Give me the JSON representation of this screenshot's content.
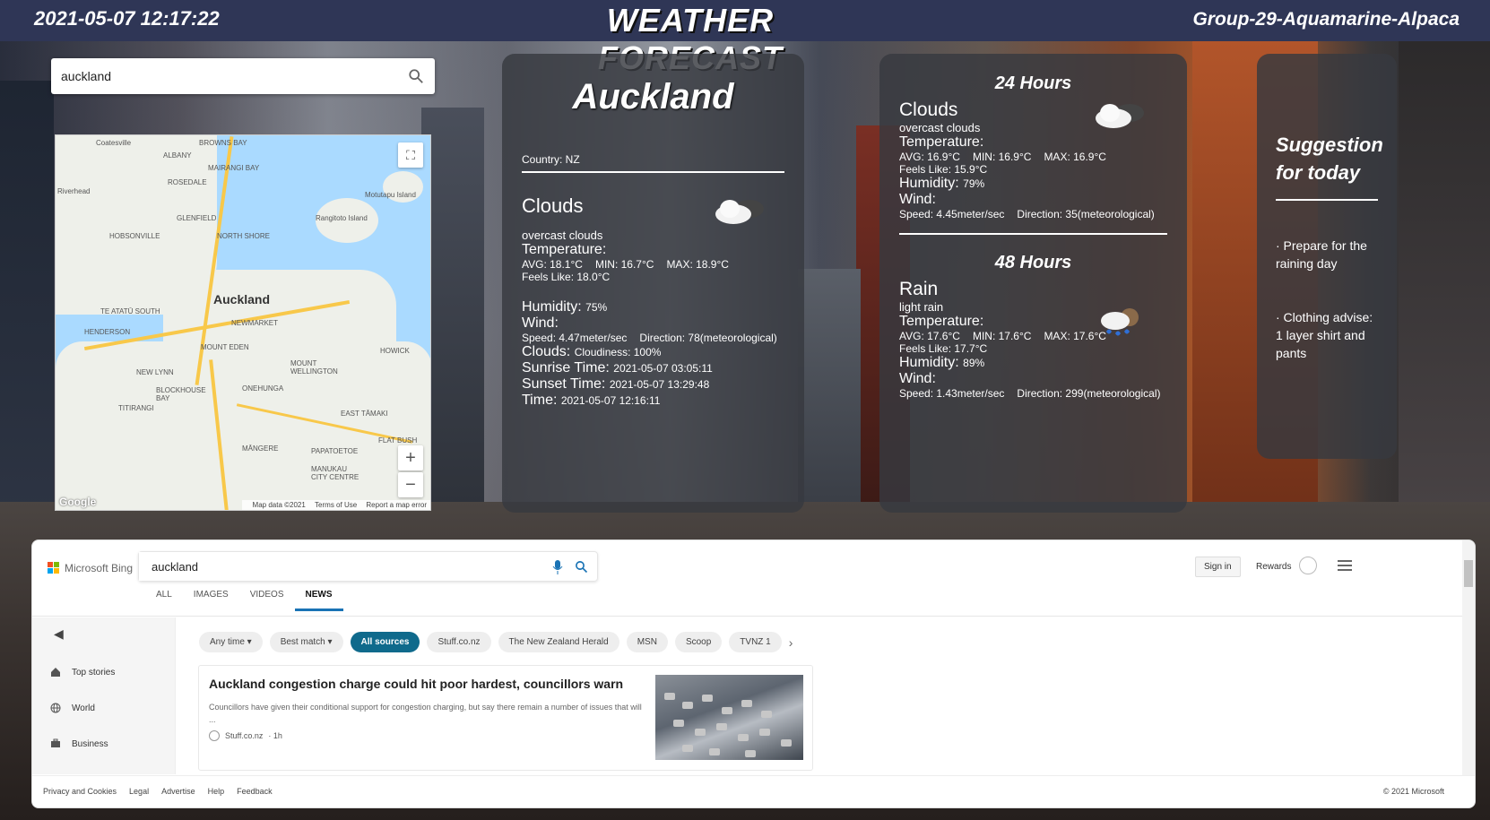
{
  "header": {
    "datetime": "2021-05-07 12:17:22",
    "brand": "Weather Forecast",
    "group": "Group-29-Aquamarine-Alpaca"
  },
  "search": {
    "value": "auckland"
  },
  "map": {
    "labels": [
      "Coatesville",
      "ALBANY",
      "ROSEDALE",
      "Riverhead",
      "GLENFIELD",
      "NORTH SHORE",
      "HOBSONVILLE",
      "Motutapu Island",
      "Rangitoto Island",
      "Auckland",
      "TE ATATŪ SOUTH",
      "HENDERSON",
      "NEWMARKET",
      "MOUNT EDEN",
      "NEW LYNN",
      "MOUNT WELLINGTON",
      "HOWICK",
      "BLOCKHOUSE BAY",
      "ONEHUNGA",
      "TITIRANGI",
      "EAST TĀMAKI",
      "MĀNGERE",
      "PAPATOETOE",
      "MANUKAU CITY CENTRE",
      "FLAT BUSH",
      "BROWNS BAY",
      "MAIRANGI BAY"
    ],
    "google": "Google",
    "map_data": "Map data ©2021",
    "terms": "Terms of Use",
    "report": "Report a map error"
  },
  "current": {
    "city": "Auckland",
    "country": "Country: NZ",
    "condition": "Clouds",
    "description": "overcast clouds",
    "temperature_label": "Temperature:",
    "avg": "AVG: 18.1°C",
    "min": "MIN: 16.7°C",
    "max": "MAX: 18.9°C",
    "feels": "Feels Like: 18.0°C",
    "humidity_label": "Humidity:",
    "humidity": "75%",
    "wind_label": "Wind:",
    "wind_speed": "Speed: 4.47meter/sec",
    "wind_dir": "Direction: 78(meteorological)",
    "clouds_label": "Clouds:",
    "cloudiness": "Cloudiness: 100%",
    "sunrise_label": "Sunrise Time:",
    "sunrise": "2021-05-07 03:05:11",
    "sunset_label": "Sunset Time:",
    "sunset": "2021-05-07 13:29:48",
    "time_label": "Time:",
    "time": "2021-05-07 12:16:11"
  },
  "forecast24": {
    "title": "24 Hours",
    "condition": "Clouds",
    "description": "overcast clouds",
    "temperature_label": "Temperature:",
    "avg": "AVG: 16.9°C",
    "min": "MIN: 16.9°C",
    "max": "MAX: 16.9°C",
    "feels": "Feels Like: 15.9°C",
    "humidity_label": "Humidity:",
    "humidity": "79%",
    "wind_label": "Wind:",
    "wind_speed": "Speed: 4.45meter/sec",
    "wind_dir": "Direction: 35(meteorological)"
  },
  "forecast48": {
    "title": "48 Hours",
    "condition": "Rain",
    "description": "light rain",
    "temperature_label": "Temperature:",
    "avg": "AVG: 17.6°C",
    "min": "MIN: 17.6°C",
    "max": "MAX: 17.6°C",
    "feels": "Feels Like: 17.7°C",
    "humidity_label": "Humidity:",
    "humidity": "89%",
    "wind_label": "Wind:",
    "wind_speed": "Speed: 1.43meter/sec",
    "wind_dir": "Direction: 299(meteorological)"
  },
  "suggestion": {
    "title_line1": "Suggestion",
    "title_line2": "for today",
    "item1": "· Prepare for the raining day",
    "item2": "· Clothing advise: 1 layer shirt and pants"
  },
  "bing": {
    "brand": "Microsoft Bing",
    "query": "auckland",
    "sign_in": "Sign in",
    "rewards": "Rewards",
    "tabs": [
      "ALL",
      "IMAGES",
      "VIDEOS",
      "NEWS"
    ],
    "active_tab": "NEWS",
    "side": [
      "Top stories",
      "World",
      "Business"
    ],
    "chips": [
      "Any time ▾",
      "Best match ▾",
      "All sources",
      "Stuff.co.nz",
      "The New Zealand Herald",
      "MSN",
      "Scoop",
      "TVNZ 1"
    ],
    "article_title": "Auckland congestion charge could hit poor hardest, councillors warn",
    "article_snippet": "Councillors have given their conditional support for congestion charging, but say there remain a number of issues that will ...",
    "article_source": "Stuff.co.nz",
    "article_time": "· 1h",
    "footer": [
      "Privacy and Cookies",
      "Legal",
      "Advertise",
      "Help",
      "Feedback"
    ],
    "copyright": "© 2021 Microsoft"
  },
  "colors": {
    "header": "#2f3656",
    "accent": "#0f6a8c",
    "bing_tab": "#1a73b5"
  }
}
